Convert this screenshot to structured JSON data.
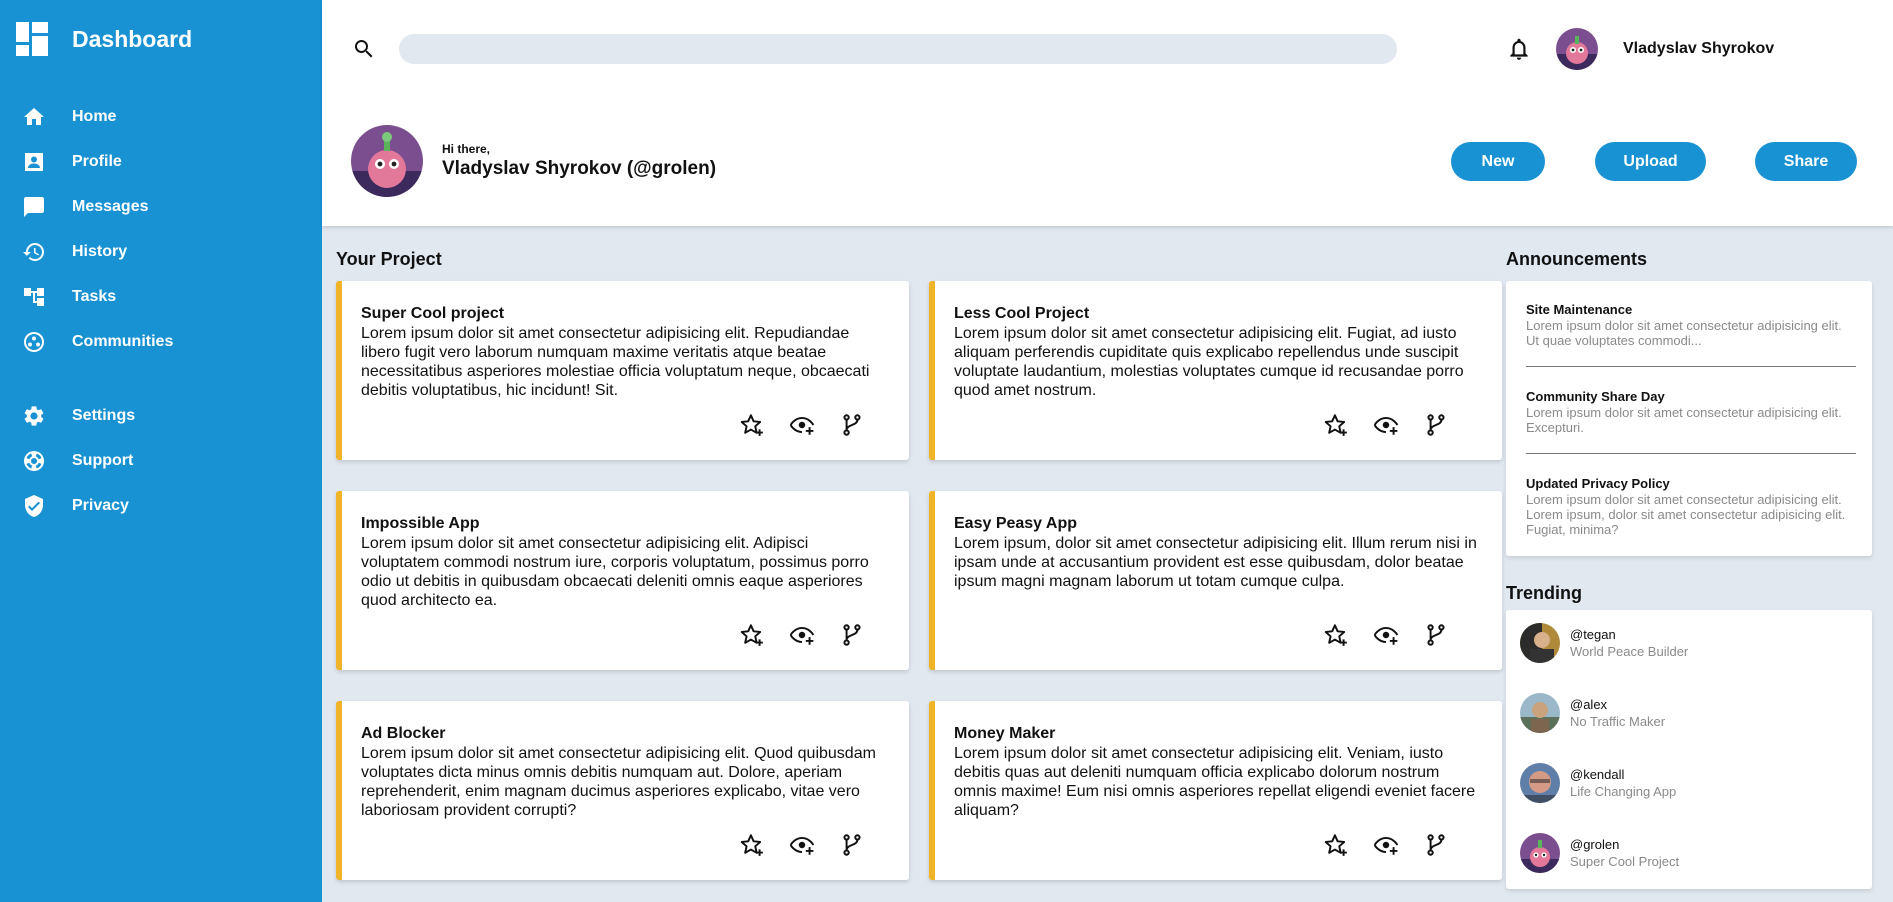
{
  "app": {
    "title": "Dashboard",
    "accent_color": "#1992d4",
    "card_accent_color": "#f0b429",
    "background_color": "#e2e8f0"
  },
  "sidebar": {
    "main_items": [
      {
        "label": "Home",
        "icon": "home-icon"
      },
      {
        "label": "Profile",
        "icon": "profile-icon"
      },
      {
        "label": "Messages",
        "icon": "messages-icon"
      },
      {
        "label": "History",
        "icon": "history-icon"
      },
      {
        "label": "Tasks",
        "icon": "tasks-icon"
      },
      {
        "label": "Communities",
        "icon": "communities-icon"
      }
    ],
    "secondary_items": [
      {
        "label": "Settings",
        "icon": "gear-icon"
      },
      {
        "label": "Support",
        "icon": "support-icon"
      },
      {
        "label": "Privacy",
        "icon": "shield-icon"
      }
    ]
  },
  "header": {
    "search": {
      "value": "",
      "placeholder": ""
    },
    "username": "Vladyslav Shyrokov",
    "greeting": "Hi there,",
    "user_full": "Vladyslav Shyrokov (@grolen)",
    "buttons": {
      "new": "New",
      "upload": "Upload",
      "share": "Share"
    }
  },
  "projects": {
    "title": "Your Project",
    "items": [
      {
        "title": "Super Cool project",
        "description": "Lorem ipsum dolor sit amet consectetur adipisicing elit. Repudiandae libero fugit vero laborum numquam maxime veritatis atque beatae necessitatibus asperiores molestiae officia voluptatum neque, obcaecati debitis voluptatibus, hic incidunt! Sit."
      },
      {
        "title": "Less Cool Project",
        "description": "Lorem ipsum dolor sit amet consectetur adipisicing elit. Fugiat, ad iusto aliquam perferendis cupiditate quis explicabo repellendus unde suscipit voluptate laudantium, molestias voluptates cumque id recusandae porro quod amet nostrum."
      },
      {
        "title": "Impossible App",
        "description": "Lorem ipsum dolor sit amet consectetur adipisicing elit. Adipisci voluptatem commodi nostrum iure, corporis voluptatum, possimus porro odio ut debitis in quibusdam obcaecati deleniti omnis eaque asperiores quod architecto ea."
      },
      {
        "title": "Easy Peasy App",
        "description": "Lorem ipsum, dolor sit amet consectetur adipisicing elit. Illum rerum nisi in ipsam unde at accusantium provident est esse quibusdam, dolor beatae ipsum magni magnam laborum ut totam cumque culpa."
      },
      {
        "title": "Ad Blocker",
        "description": "Lorem ipsum dolor sit amet consectetur adipisicing elit. Quod quibusdam voluptates dicta minus omnis debitis numquam aut. Dolore, aperiam reprehenderit, enim magnam ducimus asperiores explicabo, vitae vero laboriosam provident corrupti?"
      },
      {
        "title": "Money Maker",
        "description": "Lorem ipsum dolor sit amet consectetur adipisicing elit. Veniam, iusto debitis quas aut deleniti numquam officia explicabo dolorum nostrum omnis maxime! Eum nisi omnis asperiores repellat eligendi eveniet facere aliquam?"
      }
    ]
  },
  "announcements": {
    "title": "Announcements",
    "items": [
      {
        "title": "Site Maintenance",
        "text": "Lorem ipsum dolor sit amet consectetur adipisicing elit. Ut quae voluptates commodi..."
      },
      {
        "title": "Community Share Day",
        "text": "Lorem ipsum dolor sit amet consectetur adipisicing elit. Excepturi."
      },
      {
        "title": "Updated Privacy Policy",
        "text": "Lorem ipsum dolor sit amet consectetur adipisicing elit. Lorem ipsum, dolor sit amet consectetur adipisicing elit. Fugiat, minima?"
      }
    ]
  },
  "trending": {
    "title": "Trending",
    "items": [
      {
        "handle": "@tegan",
        "project": "World Peace Builder"
      },
      {
        "handle": "@alex",
        "project": "No Traffic Maker"
      },
      {
        "handle": "@kendall",
        "project": "Life Changing App"
      },
      {
        "handle": "@grolen",
        "project": "Super Cool Project"
      }
    ]
  }
}
